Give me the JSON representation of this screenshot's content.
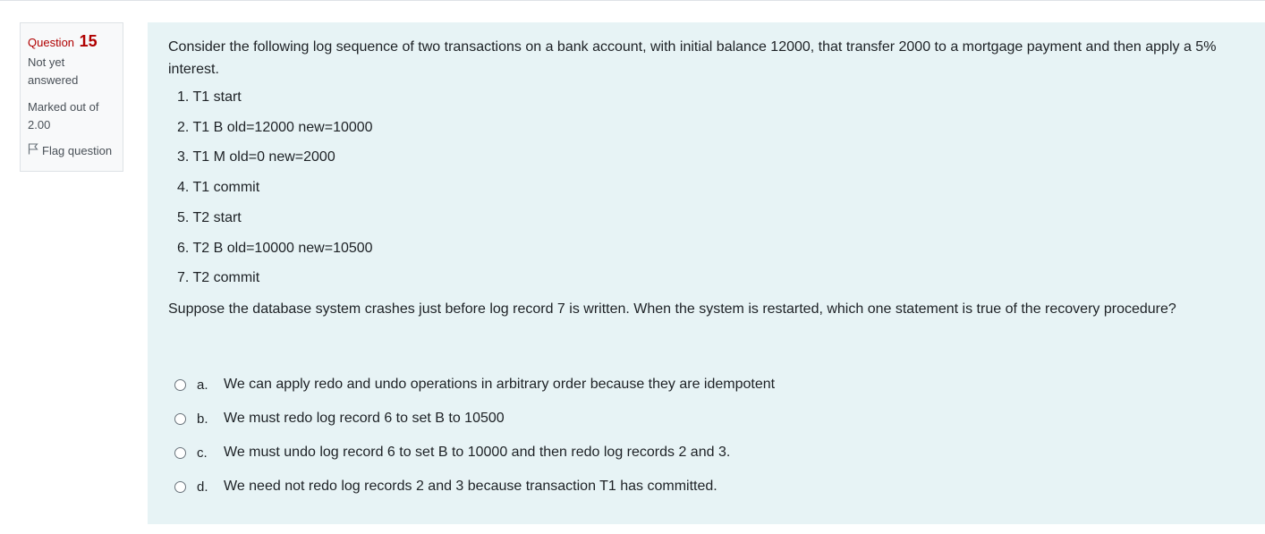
{
  "info": {
    "question_word": "Question",
    "question_number": "15",
    "state_line1": "Not yet",
    "state_line2": "answered",
    "grade_line1": "Marked out of",
    "grade_line2": "2.00",
    "flag_label": "Flag question"
  },
  "question": {
    "intro": "Consider the following log sequence of two transactions on a bank account, with initial balance 12000, that transfer 2000 to a mortgage payment and then apply a 5% interest.",
    "log": [
      "1. T1 start",
      "2. T1 B old=12000 new=10000",
      "3. T1 M old=0 new=2000",
      "4. T1 commit",
      "5. T2 start",
      "6. T2 B old=10000 new=10500",
      "7. T2 commit"
    ],
    "prompt": "Suppose the database system crashes just before log record 7 is written. When the system is restarted, which one statement is true of the recovery procedure?",
    "options": [
      {
        "letter": "a.",
        "text": "We can apply redo and undo operations in arbitrary order because they are idempotent"
      },
      {
        "letter": "b.",
        "text": "We must redo log record 6 to set B to 10500"
      },
      {
        "letter": "c.",
        "text": "We must undo log record 6 to set B to 10000 and then redo log records 2 and 3."
      },
      {
        "letter": "d.",
        "text": "We need not redo log records 2 and 3 because transaction T1 has committed."
      }
    ]
  },
  "colors": {
    "question_number": "#b00000",
    "content_background": "#e7f3f5",
    "info_background": "#f8f9fa"
  },
  "icons": {
    "flag": "flag-icon"
  }
}
